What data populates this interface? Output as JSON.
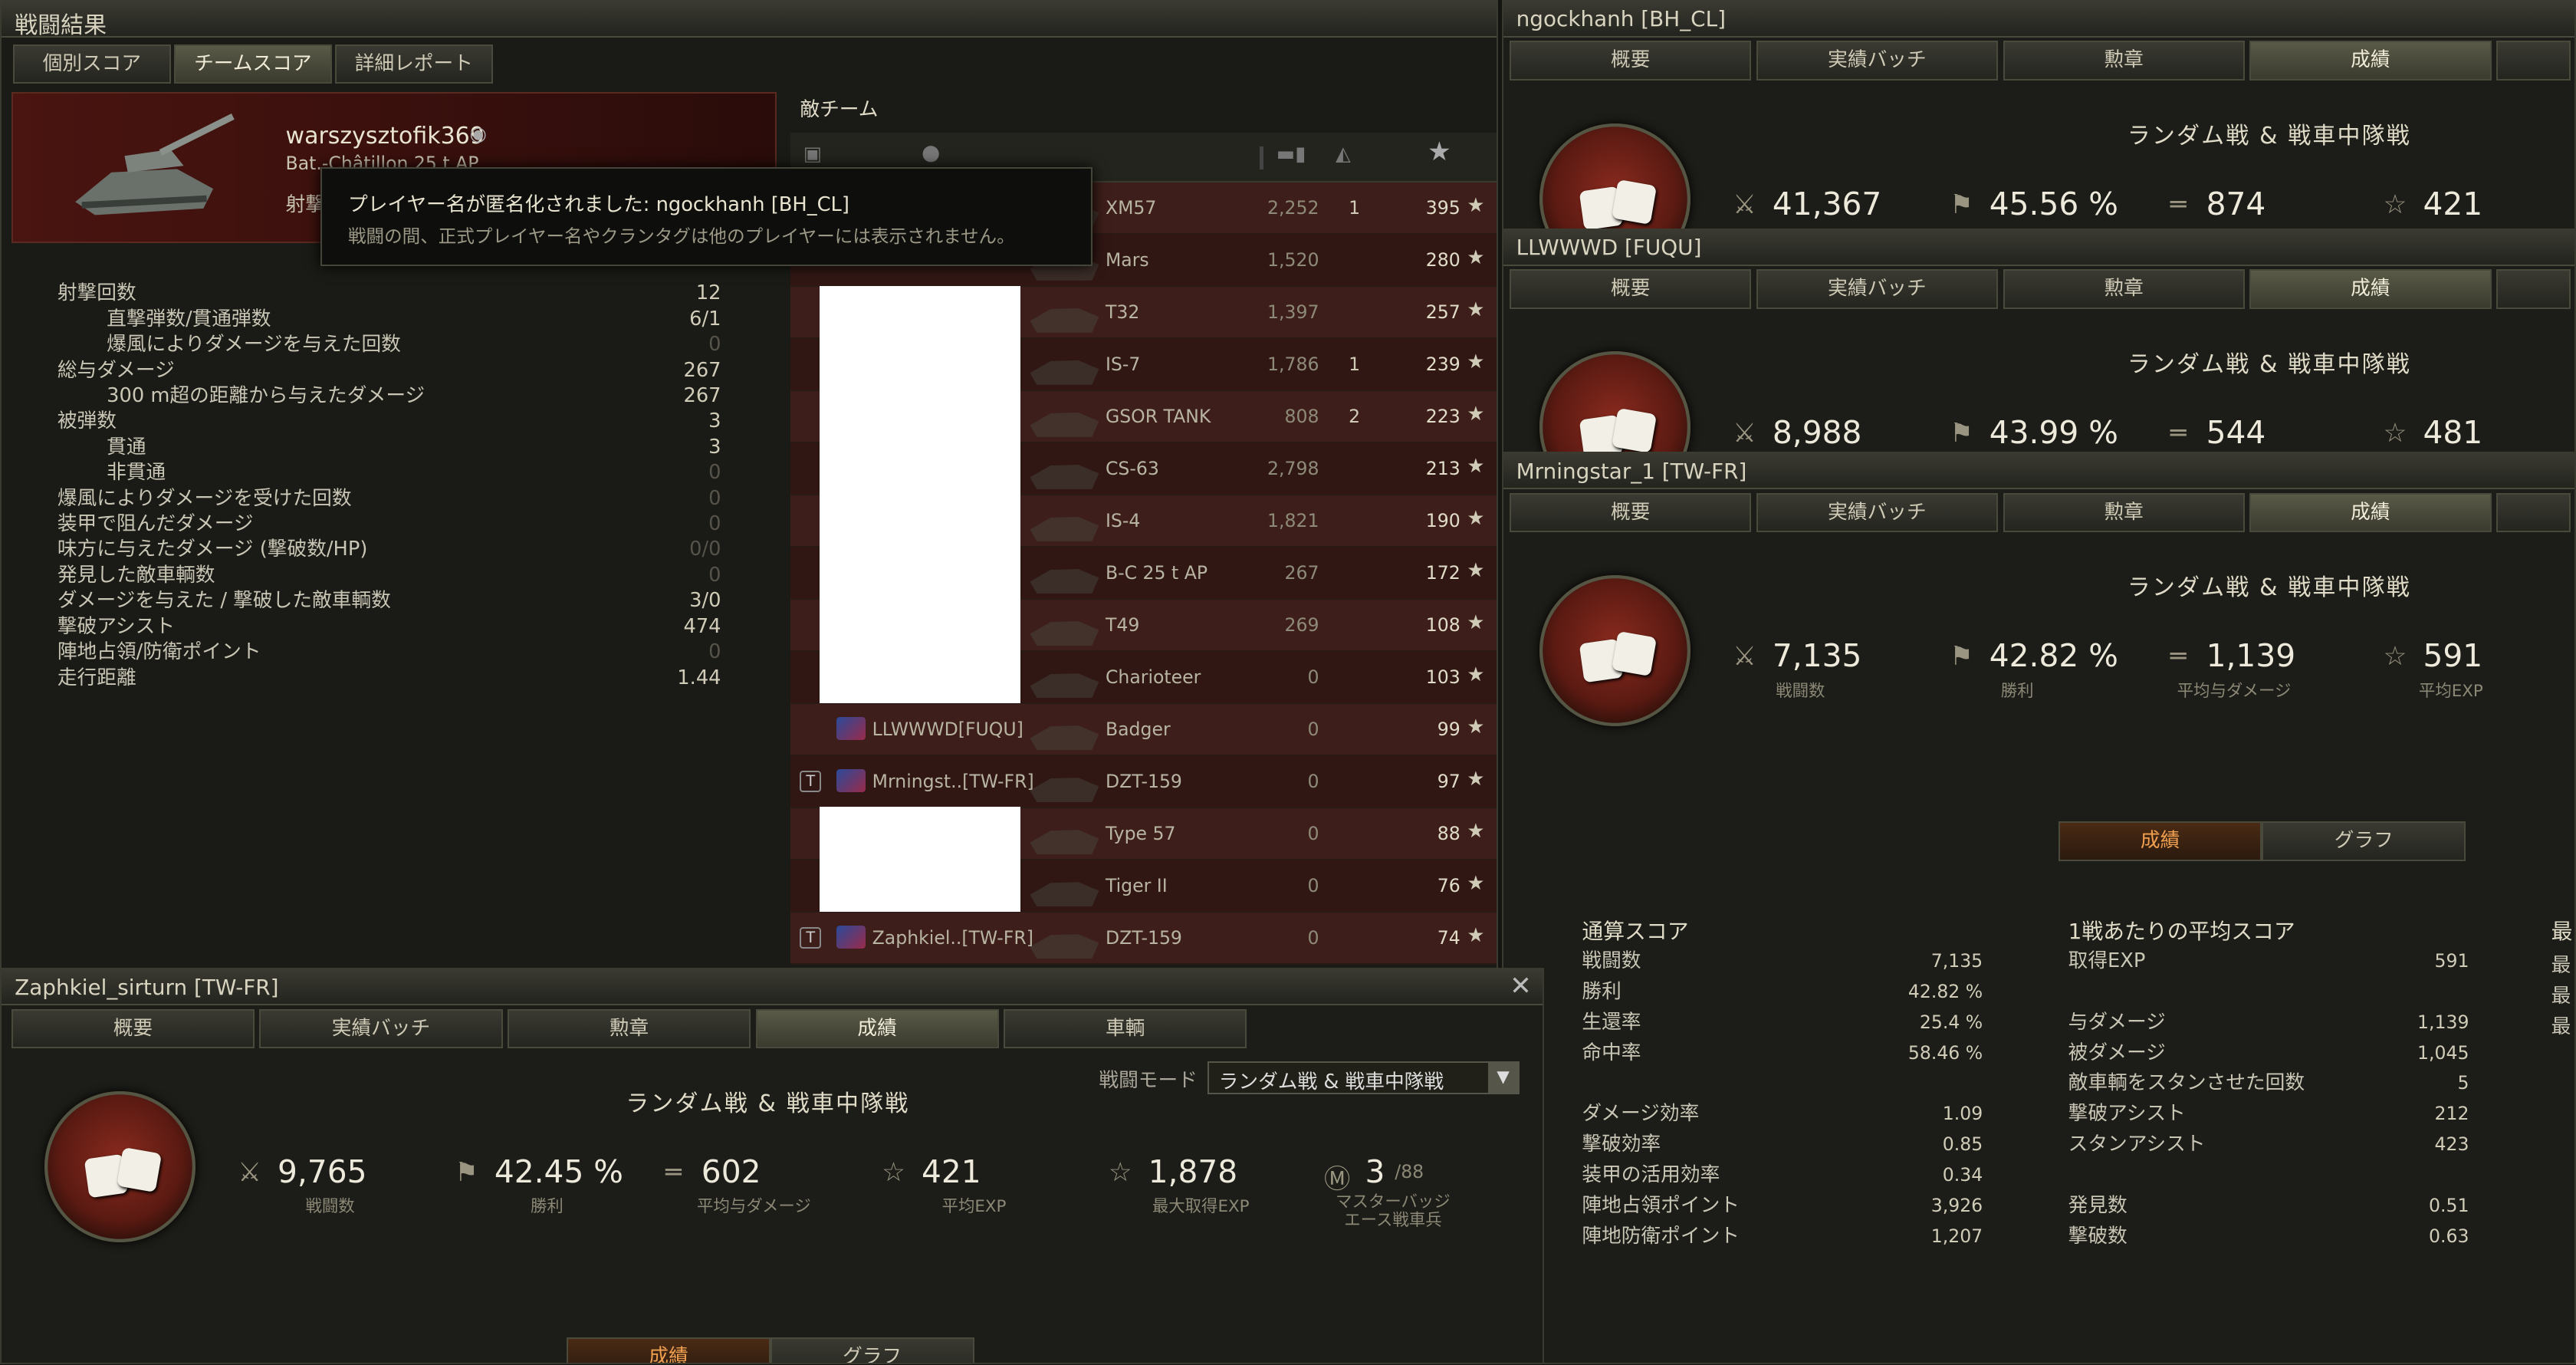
{
  "window": {
    "title": "戦闘結果",
    "tabs": [
      "個別スコア",
      "チームスコア",
      "詳細レポート"
    ],
    "active_tab": 1
  },
  "player": {
    "name": "warszysztofik369",
    "vehicle": "Bat.-Châtillon 25 t AP",
    "cut_label": "射撃"
  },
  "tooltip": {
    "title": "プレイヤー名が匿名化されました: ngockhanh [BH_CL]",
    "body": "戦闘の間、正式プレイヤー名やクランタグは他のプレイヤーには表示されません。"
  },
  "stats": [
    {
      "label": "射撃回数",
      "value": "12",
      "indent": 0,
      "dim": false
    },
    {
      "label": "直撃弾数/貫通弾数",
      "value": "6/1",
      "indent": 1,
      "dim": false
    },
    {
      "label": "爆風によりダメージを与えた回数",
      "value": "0",
      "indent": 1,
      "dim": true
    },
    {
      "label": "総与ダメージ",
      "value": "267",
      "indent": 0,
      "dim": false
    },
    {
      "label": "300 m超の距離から与えたダメージ",
      "value": "267",
      "indent": 1,
      "dim": false
    },
    {
      "label": "被弾数",
      "value": "3",
      "indent": 0,
      "dim": false
    },
    {
      "label": "貫通",
      "value": "3",
      "indent": 1,
      "dim": false
    },
    {
      "label": "非貫通",
      "value": "0",
      "indent": 1,
      "dim": true
    },
    {
      "label": "爆風によりダメージを受けた回数",
      "value": "0",
      "indent": 0,
      "dim": true
    },
    {
      "label": "装甲で阻んだダメージ",
      "value": "0",
      "indent": 0,
      "dim": true
    },
    {
      "label": "味方に与えたダメージ (撃破数/HP)",
      "value": "0/0",
      "indent": 0,
      "dim": true
    },
    {
      "label": "発見した敵車輌数",
      "value": "0",
      "indent": 0,
      "dim": true
    },
    {
      "label": "ダメージを与えた / 撃破した敵車輌数",
      "value": "3/0",
      "indent": 0,
      "dim": false
    },
    {
      "label": "撃破アシスト",
      "value": "474",
      "indent": 0,
      "dim": false
    },
    {
      "label": "陣地占領/防衛ポイント",
      "value": "0",
      "indent": 0,
      "dim": true
    },
    {
      "label": "走行距離",
      "value": "1.44",
      "indent": 0,
      "dim": false
    }
  ],
  "enemy_team": {
    "title": "敵チーム",
    "rows": [
      {
        "player": "",
        "vehicle": "XM57",
        "damage": "2,252",
        "kills": "1",
        "exp": "395"
      },
      {
        "player": "",
        "vehicle": "Mars",
        "damage": "1,520",
        "kills": "",
        "exp": "280"
      },
      {
        "player": "",
        "vehicle": "T32",
        "damage": "1,397",
        "kills": "",
        "exp": "257"
      },
      {
        "player": "",
        "vehicle": "IS-7",
        "damage": "1,786",
        "kills": "1",
        "exp": "239"
      },
      {
        "player": "",
        "vehicle": "GSOR TANK",
        "damage": "808",
        "kills": "2",
        "exp": "223"
      },
      {
        "player": "",
        "vehicle": "CS-63",
        "damage": "2,798",
        "kills": "",
        "exp": "213"
      },
      {
        "player": "",
        "vehicle": "IS-4",
        "damage": "1,821",
        "kills": "",
        "exp": "190"
      },
      {
        "player": "",
        "vehicle": "B-C 25 t AP",
        "damage": "267",
        "kills": "",
        "exp": "172"
      },
      {
        "player": "",
        "vehicle": "T49",
        "damage": "269",
        "kills": "",
        "exp": "108"
      },
      {
        "player": "",
        "vehicle": "Charioteer",
        "damage": "0",
        "kills": "",
        "exp": "103"
      },
      {
        "player": "LLWWWD[FUQU]",
        "vehicle": "Badger",
        "damage": "0",
        "kills": "",
        "exp": "99"
      },
      {
        "player": "Mrningst..[TW-FR]",
        "vehicle": "DZT-159",
        "damage": "0",
        "kills": "",
        "exp": "97"
      },
      {
        "player": "",
        "vehicle": "Type 57",
        "damage": "0",
        "kills": "",
        "exp": "88"
      },
      {
        "player": "",
        "vehicle": "Tiger II",
        "damage": "0",
        "kills": "",
        "exp": "76"
      },
      {
        "player": "Zaphkiel..[TW-FR]",
        "vehicle": "DZT-159",
        "damage": "0",
        "kills": "",
        "exp": "74"
      }
    ]
  },
  "profile_tabs": [
    "概要",
    "実績バッチ",
    "勲章",
    "成績"
  ],
  "mode_title": "ランダム戦 & 戦車中隊戦",
  "profiles": [
    {
      "name": "ngockhanh [BH_CL]",
      "battles": "41,367",
      "winrate": "45.56 %",
      "avgdmg": "874",
      "avgexp": "421"
    },
    {
      "name": "LLWWWD [FUQU]",
      "battles": "8,988",
      "winrate": "43.99 %",
      "avgdmg": "544",
      "avgexp": "481"
    },
    {
      "name": "Mrningstar_1 [TW-FR]",
      "battles": "7,135",
      "winrate": "42.82 %",
      "avgdmg": "1,139",
      "avgexp": "591",
      "lab_battles": "戦闘数",
      "lab_win": "勝利",
      "lab_dmg": "平均与ダメージ",
      "lab_exp": "平均EXP",
      "subtabs": [
        "成績",
        "グラフ"
      ],
      "total_title": "通算スコア",
      "total": [
        [
          "戦闘数",
          "7,135"
        ],
        [
          "勝利",
          "42.82 %"
        ],
        [
          "生還率",
          "25.4 %"
        ],
        [
          "命中率",
          "58.46 %"
        ],
        [
          "",
          ""
        ],
        [
          "ダメージ効率",
          "1.09"
        ],
        [
          "撃破効率",
          "0.85"
        ],
        [
          "装甲の活用効率",
          "0.34"
        ],
        [
          "陣地占領ポイント",
          "3,926"
        ],
        [
          "陣地防衛ポイント",
          "1,207"
        ]
      ],
      "avg_title": "1戦あたりの平均スコア",
      "avg": [
        [
          "取得EXP",
          "591"
        ],
        [
          "",
          ""
        ],
        [
          "与ダメージ",
          "1,139"
        ],
        [
          "被ダメージ",
          "1,045"
        ],
        [
          "敵車輌をスタンさせた回数",
          "5"
        ],
        [
          "撃破アシスト",
          "212"
        ],
        [
          "スタンアシスト",
          "423"
        ],
        [
          "",
          ""
        ],
        [
          "発見数",
          "0.51"
        ],
        [
          "撃破数",
          "0.63"
        ]
      ],
      "max_title": "最",
      "max_rows": [
        "最",
        "最",
        "最"
      ]
    }
  ],
  "bottom_profile": {
    "name": "Zaphkiel_sirturn [TW-FR]",
    "tabs": [
      "概要",
      "実績バッチ",
      "勲章",
      "成績",
      "車輌"
    ],
    "mode_label": "戦闘モード",
    "mode_value": "ランダム戦 & 戦車中隊戦",
    "battles": "9,765",
    "winrate": "42.45 %",
    "avgdmg": "602",
    "avgexp": "421",
    "maxexp": "1,878",
    "mastery": "3",
    "mastery_total": "/88",
    "lab_battles": "戦闘数",
    "lab_win": "勝利",
    "lab_dmg": "平均与ダメージ",
    "lab_exp": "平均EXP",
    "lab_maxexp": "最大取得EXP",
    "lab_mastery": "マスターバッジ\nエース戦車兵",
    "subtabs": [
      "成績",
      "グラフ"
    ]
  }
}
